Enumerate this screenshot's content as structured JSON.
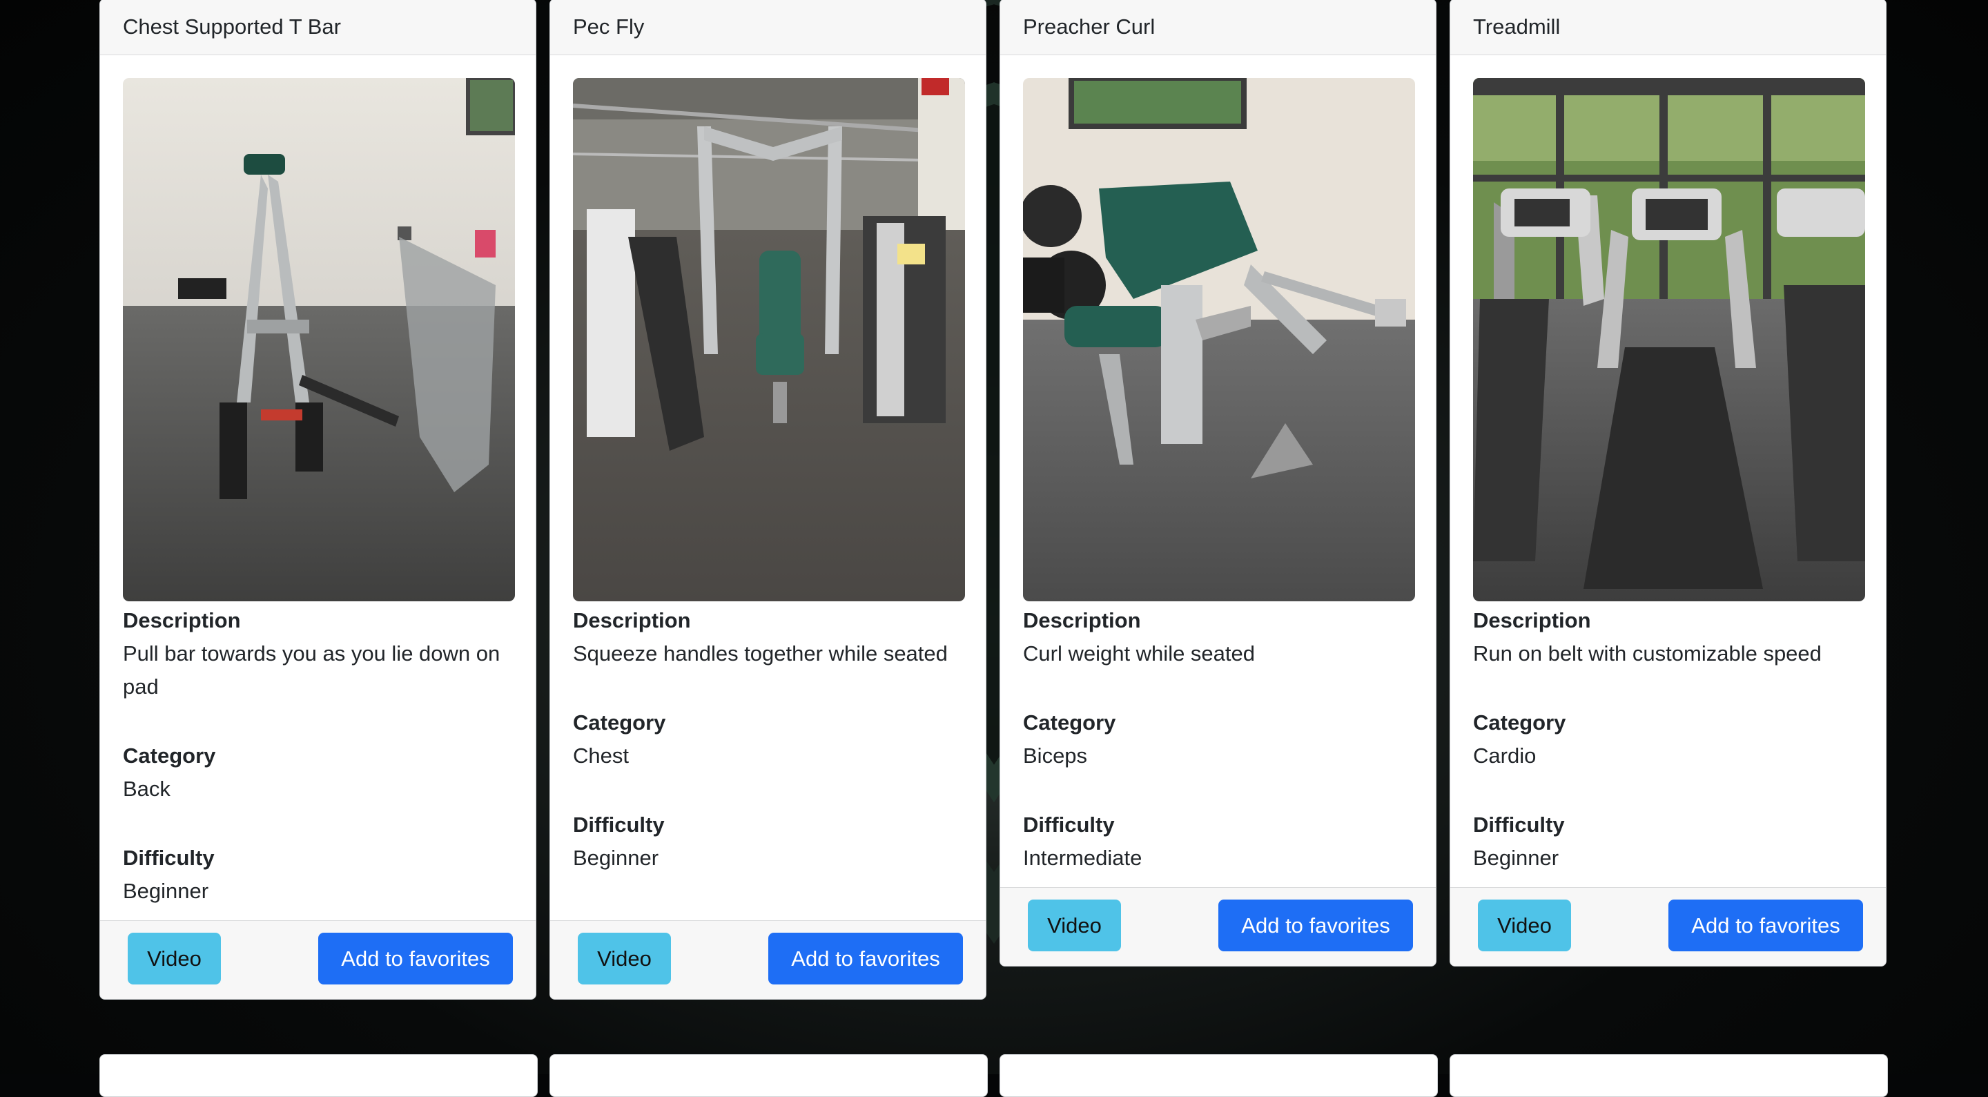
{
  "labels": {
    "description": "Description",
    "category": "Category",
    "difficulty": "Difficulty",
    "video_button": "Video",
    "favorites_button": "Add to favorites"
  },
  "cards": [
    {
      "title": "Chest Supported T Bar",
      "description": "Pull bar towards you as you lie down on pad",
      "category": "Back",
      "difficulty": "Beginner"
    },
    {
      "title": "Pec Fly",
      "description": "Squeeze handles together while seated",
      "category": "Chest",
      "difficulty": "Beginner"
    },
    {
      "title": "Preacher Curl",
      "description": "Curl weight while seated",
      "category": "Biceps",
      "difficulty": "Intermediate"
    },
    {
      "title": "Treadmill",
      "description": "Run on belt with customizable speed",
      "category": "Cardio",
      "difficulty": "Beginner"
    }
  ],
  "colors": {
    "video_button": "#4fc3e8",
    "favorites_button": "#1e6ef5",
    "card_header": "#f7f7f7",
    "page_background": "#050607"
  }
}
